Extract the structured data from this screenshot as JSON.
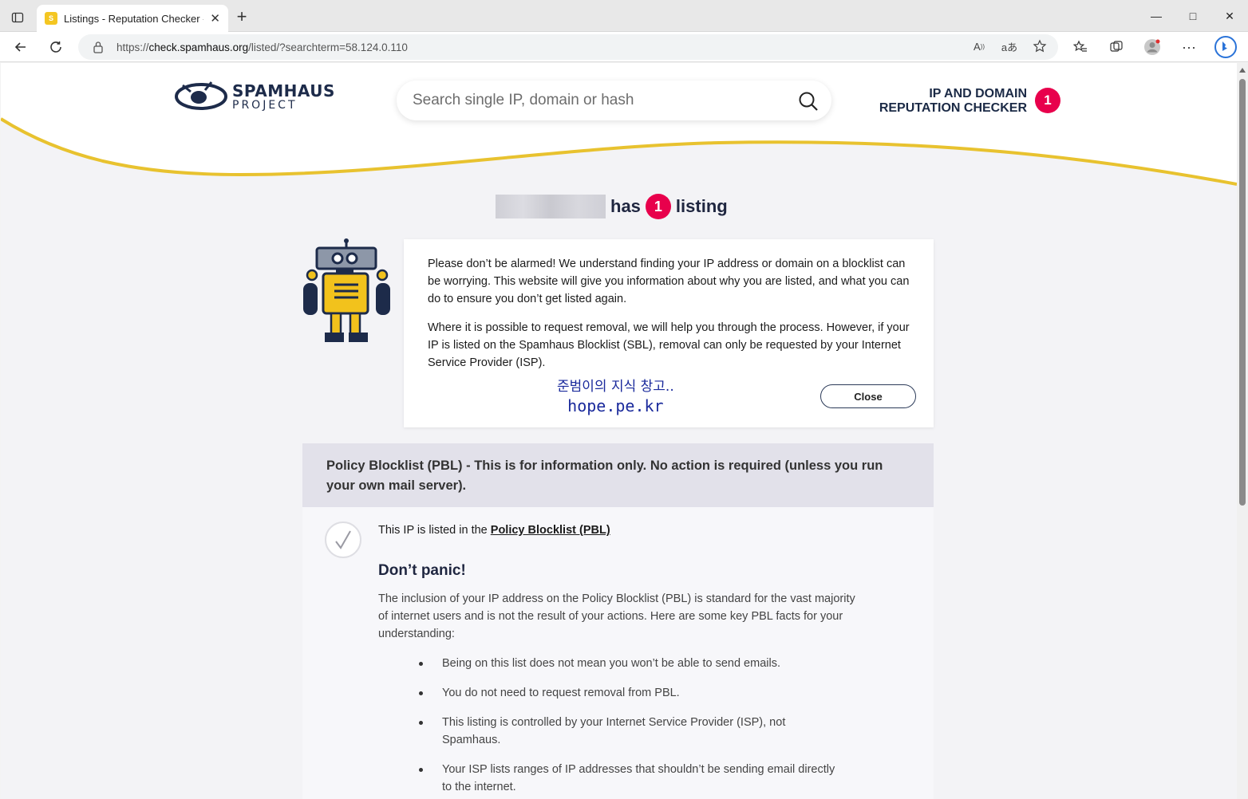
{
  "browser": {
    "tab_title": "Listings - Reputation Checker - S",
    "url_prefix": "https://",
    "url_host": "check.spamhaus.org",
    "url_path": "/listed/?searchterm=58.124.0.110"
  },
  "site": {
    "logo_line1": "SPAMHAUS",
    "logo_line2": "PROJECT",
    "search_placeholder": "Search single IP, domain or hash",
    "checker_line1": "IP AND DOMAIN",
    "checker_line2": "REPUTATION CHECKER",
    "checker_count": "1"
  },
  "headline": {
    "has": "has",
    "count": "1",
    "listing": "listing"
  },
  "notice": {
    "para1": "Please don’t be alarmed! We understand finding your IP address or domain on a blocklist can be worrying. This website will give you information about why you are listed, and what you can do to ensure you don’t get listed again.",
    "para2": "Where it is possible to request removal, we will help you through the process. However, if your IP is listed on the Spamhaus Blocklist (SBL), removal can only be requested by your Internet Service Provider (ISP).",
    "watermark_korean": "준범이의 지식 창고..",
    "watermark_url": "hope.pe.kr",
    "close_label": "Close"
  },
  "pbl": {
    "header": "Policy Blocklist (PBL) - This is for information only. No action is required (unless you run your own mail server).",
    "listed_prefix": "This IP is listed in the ",
    "listed_link": "Policy Blocklist (PBL)",
    "heading": "Don’t panic!",
    "intro": "The inclusion of your IP address on the Policy Blocklist (PBL) is standard for the vast majority of internet users and is not the result of your actions. Here are some key PBL facts for your understanding:",
    "bullets": [
      "Being on this list does not mean you won’t be able to send emails.",
      "You do not need to request removal from PBL.",
      "This listing is controlled by your Internet Service Provider (ISP), not Spamhaus.",
      "Your ISP lists ranges of IP addresses that shouldn’t be sending email directly to the internet."
    ]
  },
  "colors": {
    "accent_pink": "#e8004c",
    "wave_yellow": "#e8c22f",
    "navy": "#1d2b4a"
  }
}
